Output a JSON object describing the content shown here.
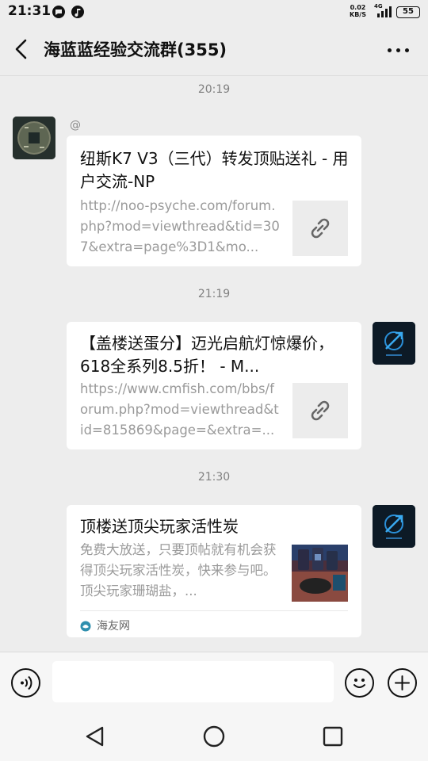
{
  "status_bar": {
    "time": "21:31",
    "net_speed_value": "0.02",
    "net_speed_unit": "KB/S",
    "network_type": "4G",
    "battery": "55",
    "icons": [
      "chat-bubble-icon",
      "music-app-icon",
      "signal-icon",
      "battery-icon"
    ]
  },
  "header": {
    "title": "海蓝蓝经验交流群(355)",
    "back_icon": "chevron-left-icon",
    "more_icon": "more-dots-icon"
  },
  "messages": [
    {
      "timestamp": "20:19",
      "sender": "@",
      "side": "left",
      "avatar": "coin-avatar",
      "title": "纽斯K7 V3（三代）转发顶贴送礼 - 用户交流-NP",
      "description": "http://noo-psyche.com/forum.php?mod=viewthread&tid=307&extra=page%3D1&mo...",
      "thumbnail": "link-icon"
    },
    {
      "timestamp": "21:19",
      "side": "right",
      "avatar": "brand-logo-avatar",
      "title": "【盖楼送蛋分】迈光启航灯惊爆价，618全系列8.5折！ - M...",
      "description": "https://www.cmfish.com/bbs/forum.php?mod=viewthread&tid=815869&page=&extra=...",
      "thumbnail": "link-icon"
    },
    {
      "timestamp": "21:30",
      "side": "right",
      "avatar": "brand-logo-avatar",
      "title": "顶楼送顶尖玩家活性炭",
      "description": "免费大放送，只要顶帖就有机会获得顶尖玩家活性炭，快来参与吧。顶尖玩家珊瑚盐，...",
      "thumbnail": "product-photo",
      "source": "海友网",
      "source_icon": "site-logo-icon"
    }
  ],
  "input_bar": {
    "placeholder": "",
    "voice_icon": "voice-icon",
    "emoji_icon": "emoji-icon",
    "plus_icon": "plus-icon"
  },
  "nav_bar": {
    "icons": [
      "back-triangle-icon",
      "home-circle-icon",
      "recents-square-icon"
    ]
  },
  "colors": {
    "background": "#ededed",
    "card": "#ffffff",
    "timestamp": "#808080",
    "description": "#9a9a9a",
    "accent_logo": "#2a8fd8"
  }
}
